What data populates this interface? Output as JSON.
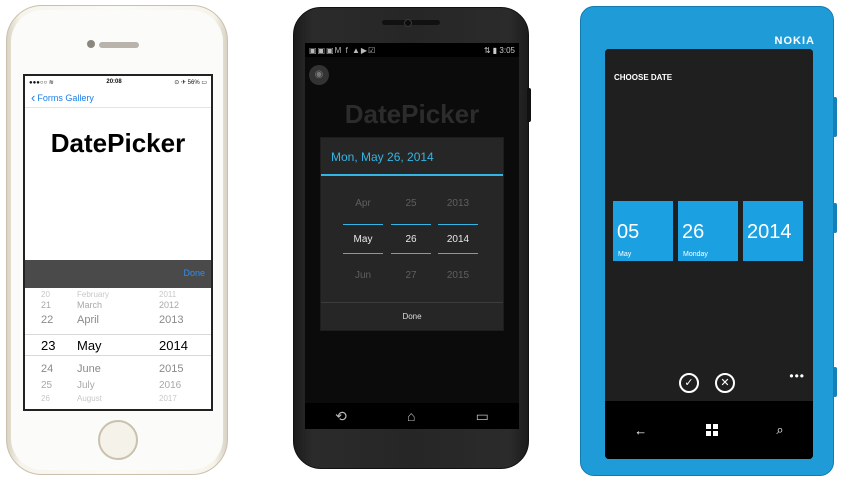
{
  "ios": {
    "status": {
      "signal": "●●●○○ ≋",
      "time": "20:08",
      "battery": "⊙ ✈ 56% ▭"
    },
    "nav": {
      "back_label": "Forms Gallery"
    },
    "title": "DatePicker",
    "toolbar": {
      "done_label": "Done"
    },
    "picker": {
      "rows": [
        {
          "day": "20",
          "month": "February",
          "year": "2011"
        },
        {
          "day": "21",
          "month": "March",
          "year": "2012"
        },
        {
          "day": "22",
          "month": "April",
          "year": "2013"
        },
        {
          "day": "23",
          "month": "May",
          "year": "2014"
        },
        {
          "day": "24",
          "month": "June",
          "year": "2015"
        },
        {
          "day": "25",
          "month": "July",
          "year": "2016"
        },
        {
          "day": "26",
          "month": "August",
          "year": "2017"
        }
      ]
    }
  },
  "android": {
    "status": {
      "icons": "▣▣▣M f ▲▶☑",
      "right_icons": "⇅ ▮",
      "time": "3:05"
    },
    "title": "DatePicker",
    "dialog": {
      "header": "Mon, May 26, 2014",
      "months": [
        "Apr",
        "May",
        "Jun"
      ],
      "days": [
        "25",
        "26",
        "27"
      ],
      "years": [
        "2013",
        "2014",
        "2015"
      ],
      "done_label": "Done"
    },
    "nav": {
      "back": "⟲",
      "home": "⌂",
      "recent": "▭"
    }
  },
  "nokia": {
    "brand": "NOKIA",
    "title": "CHOOSE DATE",
    "tiles": [
      {
        "value": "05",
        "label": "May"
      },
      {
        "value": "26",
        "label": "Monday"
      },
      {
        "value": "2014",
        "label": ""
      }
    ],
    "appbar": {
      "ok": "✓",
      "cancel": "✕",
      "more": "•••"
    },
    "nav": {
      "back": "←",
      "search": "⌕"
    }
  }
}
